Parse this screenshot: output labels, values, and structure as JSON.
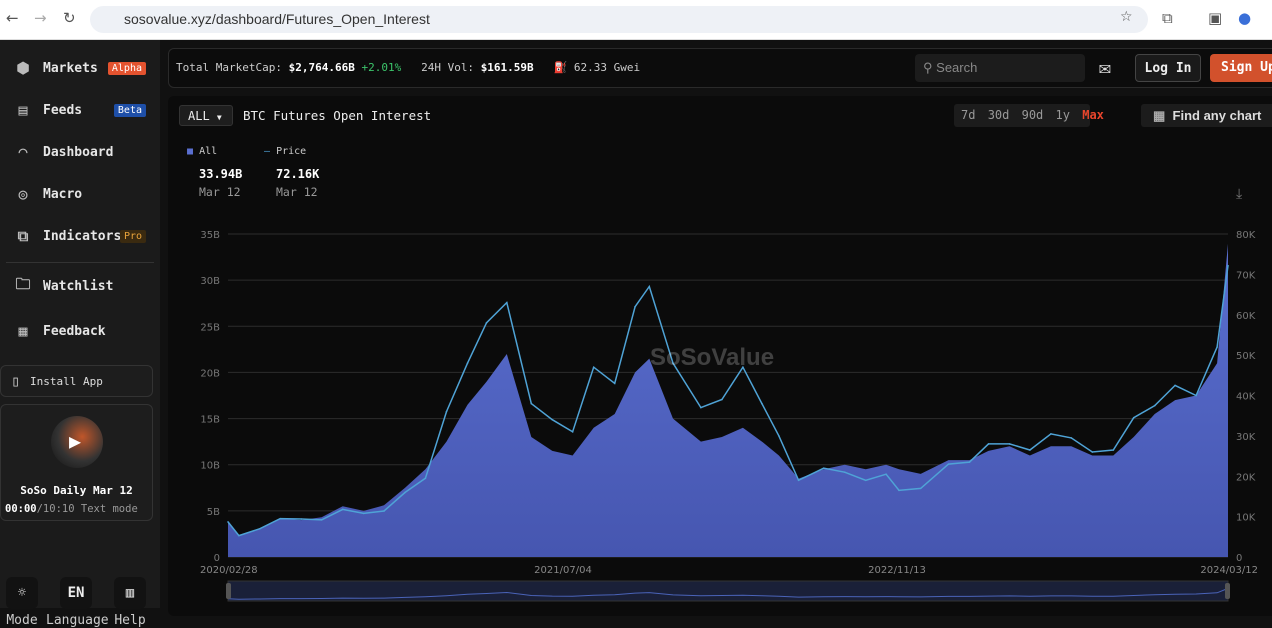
{
  "browser": {
    "url": "sosovalue.xyz/dashboard/Futures_Open_Interest"
  },
  "sidebar": {
    "items": [
      {
        "label": "Markets",
        "icon": "cube-icon",
        "badge": "Alpha",
        "badge_color": "#e4532f"
      },
      {
        "label": "Feeds",
        "icon": "newspaper-icon",
        "badge": "Beta",
        "badge_color": "#1e4fa8"
      },
      {
        "label": "Dashboard",
        "icon": "gauge-icon"
      },
      {
        "label": "Macro",
        "icon": "globe-icon"
      },
      {
        "label": "Indicators",
        "icon": "indicator-icon",
        "badge": "Pro",
        "badge_color": "#e8a33a"
      },
      {
        "label": "Watchlist",
        "icon": "folder-star-icon"
      },
      {
        "label": "Feedback",
        "icon": "clipboard-icon"
      }
    ],
    "install_app": "Install App",
    "podcast": {
      "title": "SoSo Daily Mar 12",
      "current": "00:00",
      "total": "/10:10",
      "text_mode": "Text mode"
    },
    "bottom": [
      {
        "label": "Mode",
        "icon": "sun-icon",
        "glyph": "☼"
      },
      {
        "label": "Language",
        "glyph": "EN"
      },
      {
        "label": "Help",
        "icon": "book-icon",
        "glyph": "📖"
      }
    ]
  },
  "topbar": {
    "marketcap_label": "Total MarketCap:",
    "marketcap_value": "$2,764.66B",
    "marketcap_change": "+2.01%",
    "vol_label": "24H Vol:",
    "vol_value": "$161.59B",
    "gas_value": "62.33",
    "gas_unit": "Gwei",
    "search_placeholder": "Search",
    "login": "Log In",
    "signup": "Sign Up"
  },
  "chart_header": {
    "select": "ALL",
    "title": "BTC Futures Open Interest",
    "ranges": [
      "7d",
      "30d",
      "90d",
      "1y",
      "Max"
    ],
    "active_range": "Max",
    "find": "Find any chart"
  },
  "legend": [
    {
      "name": "All",
      "value": "33.94B",
      "date": "Mar 12",
      "color": "#5a6fd0"
    },
    {
      "name": "Price",
      "value": "72.16K",
      "date": "Mar 12",
      "color": "#4fa3d6"
    }
  ],
  "watermark": "SoSoValue",
  "chart_data": {
    "type": "area",
    "x_ticks": [
      "2020/02/28",
      "2021/07/04",
      "2022/11/13",
      "2024/03/12"
    ],
    "y_left_ticks": [
      "0",
      "5B",
      "10B",
      "15B",
      "20B",
      "25B",
      "30B",
      "35B"
    ],
    "y_right_ticks": [
      "0",
      "10K",
      "20K",
      "30K",
      "40K",
      "50K",
      "60K",
      "70K",
      "80K"
    ],
    "y_left_range": [
      0,
      35
    ],
    "y_right_range": [
      0,
      80
    ],
    "grid": true,
    "x": [
      "2020-02-28",
      "2020-03-15",
      "2020-04-15",
      "2020-05-15",
      "2020-06-15",
      "2020-07-15",
      "2020-08-15",
      "2020-09-15",
      "2020-10-15",
      "2020-11-15",
      "2020-12-15",
      "2021-01-15",
      "2021-02-15",
      "2021-03-15",
      "2021-04-14",
      "2021-05-20",
      "2021-06-20",
      "2021-07-20",
      "2021-08-20",
      "2021-09-20",
      "2021-10-20",
      "2021-11-10",
      "2021-12-15",
      "2022-01-25",
      "2022-02-25",
      "2022-03-28",
      "2022-04-25",
      "2022-05-20",
      "2022-06-18",
      "2022-07-25",
      "2022-08-25",
      "2022-09-25",
      "2022-10-25",
      "2022-11-13",
      "2022-12-15",
      "2023-01-25",
      "2023-02-25",
      "2023-03-25",
      "2023-04-25",
      "2023-05-25",
      "2023-06-25",
      "2023-07-25",
      "2023-08-25",
      "2023-09-25",
      "2023-10-25",
      "2023-11-25",
      "2023-12-25",
      "2024-01-25",
      "2024-02-25",
      "2024-03-12"
    ],
    "series": [
      {
        "name": "All",
        "axis": "left",
        "unit": "B",
        "values": [
          3.8,
          2.4,
          3.0,
          4.2,
          4.0,
          4.3,
          5.5,
          5.0,
          5.6,
          7.5,
          9.5,
          12.5,
          16.5,
          19,
          22,
          13,
          11.5,
          11,
          14,
          15.5,
          20,
          21.5,
          15,
          12.5,
          13,
          14,
          12.5,
          11,
          8.5,
          9.5,
          10,
          9.5,
          10,
          9.5,
          9,
          10.5,
          10.5,
          11.5,
          12,
          11,
          12,
          12,
          11,
          11,
          13,
          15.5,
          17,
          17.5,
          21,
          33.94
        ]
      },
      {
        "name": "Price",
        "axis": "right",
        "unit": "K",
        "values": [
          8.7,
          5.3,
          7.0,
          9.5,
          9.4,
          9.2,
          11.8,
          10.8,
          11.4,
          16.0,
          19.5,
          36,
          48,
          58,
          63,
          38,
          34,
          31,
          47,
          43,
          62,
          67,
          48,
          37,
          39,
          47,
          38,
          30,
          19,
          22,
          21,
          19,
          20.5,
          16.5,
          17,
          23,
          23.5,
          28,
          28,
          26.5,
          30.5,
          29.5,
          26,
          26.5,
          34.5,
          37.5,
          42.5,
          40,
          52,
          72.16
        ]
      }
    ]
  }
}
